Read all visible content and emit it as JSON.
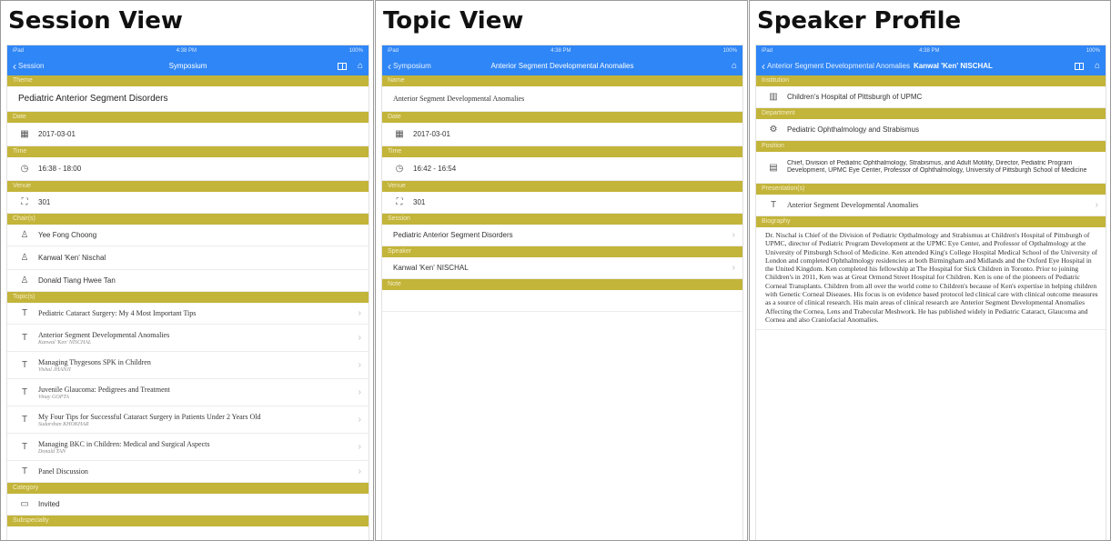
{
  "panels": {
    "session": {
      "heading": "Session View",
      "status": {
        "left": "iPad",
        "time": "4:38 PM",
        "right": "100%"
      },
      "nav": {
        "back": "Session",
        "title": "Symposium"
      },
      "theme": {
        "label": "Theme",
        "value": "Pediatric Anterior Segment Disorders"
      },
      "date": {
        "label": "Date",
        "value": "2017-03-01"
      },
      "time": {
        "label": "Time",
        "value": "16:38 - 18:00"
      },
      "venue": {
        "label": "Venue",
        "value": "301"
      },
      "chairs": {
        "label": "Chair(s)",
        "items": [
          "Yee Fong Choong",
          "Kanwal 'Ken' Nischal",
          "Donald Tiang Hwee Tan"
        ]
      },
      "topics": {
        "label": "Topic(s)",
        "items": [
          {
            "title": "Pediatric Cataract Surgery: My 4 Most Important Tips",
            "speaker": ""
          },
          {
            "title": "Anterior Segment Developmental Anomalies",
            "speaker": "Kanwal 'Ken' NISCHAL"
          },
          {
            "title": "Managing Thygesons SPK in Children",
            "speaker": "Vishal JHANJI"
          },
          {
            "title": "Juvenile Glaucoma: Pedigrees and Treatment",
            "speaker": "Vinay GOPTA"
          },
          {
            "title": "My Four Tips for Successful Cataract Surgery in Patients Under 2 Years Old",
            "speaker": "Sudarshan KHOKHAR"
          },
          {
            "title": "Managing BKC in Children: Medical and Surgical Aspects",
            "speaker": "Donald TAN"
          },
          {
            "title": "Panel Discussion",
            "speaker": ""
          }
        ]
      },
      "category": {
        "label": "Category",
        "value": "Invited"
      },
      "subspecialty": {
        "label": "Subspecialty"
      }
    },
    "topic": {
      "heading": "Topic View",
      "status": {
        "left": "iPad",
        "time": "4:38 PM",
        "right": "100%"
      },
      "nav": {
        "back": "Symposium",
        "title": "Anterior Segment Developmental Anomalies"
      },
      "name": {
        "label": "Name",
        "value": "Anterior Segment Developmental Anomalies"
      },
      "date": {
        "label": "Date",
        "value": "2017-03-01"
      },
      "time": {
        "label": "Time",
        "value": "16:42 - 16:54"
      },
      "venue": {
        "label": "Venue",
        "value": "301"
      },
      "session": {
        "label": "Session",
        "value": "Pediatric Anterior Segment Disorders"
      },
      "speaker": {
        "label": "Speaker",
        "value": "Kanwal 'Ken' NISCHAL"
      },
      "note": {
        "label": "Note"
      }
    },
    "speaker": {
      "heading": "Speaker Profile",
      "status": {
        "left": "iPad",
        "time": "4:38 PM",
        "right": "100%"
      },
      "nav": {
        "back": "Anterior Segment Developmental Anomalies",
        "title": "Kanwal 'Ken' NISCHAL"
      },
      "institution": {
        "label": "Institution",
        "value": "Children's Hospital of Pittsburgh of UPMC"
      },
      "department": {
        "label": "Department",
        "value": "Pediatric Ophthalmology and Strabismus"
      },
      "position": {
        "label": "Position",
        "value": "Chief, Division of Pediatric Ophthalmology, Strabismus, and Adult Motility, Director, Pediatric Program Development, UPMC Eye Center, Professor of Ophthalmology, University of Pittsburgh School of Medicine"
      },
      "presentations": {
        "label": "Presentation(s)",
        "value": "Anterior Segment Developmental Anomalies"
      },
      "biography": {
        "label": "Biography",
        "text": "Dr. Nischal is Chief of the Division of Pediatric Opthalmology and Strabismus at Children's Hospital of Pittsburgh of UPMC, director of Pediatric Program Development at the UPMC Eye Center, and Professor of Opthalmology at the University of Pittsburgh School of Medicine. Ken attended King's College Hospital Medical School of the University of London and completed Ophthalmology residencies at both Birmingham and Midlands and the Oxford Eye Hospital in the United Kingdom. Ken completed his fellowship at The Hospital for Sick Children in Toronto. Prior to joining Children's in 2011, Ken was at Great Ormond Street Hospital for Children. Ken is one of the pioneers of Pediatric Corneal Transplants. Children from all over the world come to Children's because of Ken's expertise in helping children with Genetic Corneal Diseases. His focus is on evidence based protocol led clinical care with clinical outcome measures as a source of clinical research. His main areas of clinical research are Anterior Segment Developmental Anomalies Affecting the Cornea, Lens and Trabecular Meshwork. He has published widely in Pediatric Cataract, Glaucoma and Cornea and also Craniofacial Anomalies."
      }
    }
  },
  "colors": {
    "nav": "#2f86f6",
    "section": "#c3b43a"
  }
}
